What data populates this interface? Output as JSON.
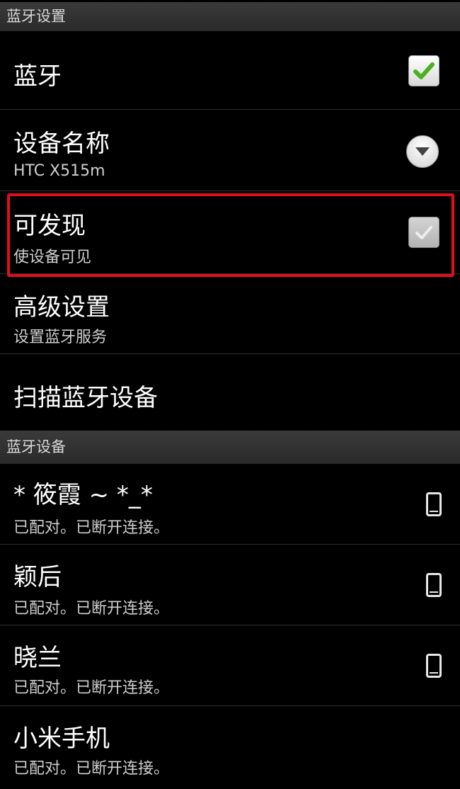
{
  "header_settings": {
    "label": "蓝牙设置"
  },
  "bluetooth": {
    "title": "蓝牙",
    "checked": true
  },
  "device_name": {
    "title": "设备名称",
    "value": "HTC X515m"
  },
  "discoverable": {
    "title": "可发现",
    "summary": "使设备可见",
    "checked": true
  },
  "advanced": {
    "title": "高级设置",
    "summary": "设置蓝牙服务"
  },
  "scan": {
    "title": "扫描蓝牙设备"
  },
  "header_devices": {
    "label": "蓝牙设备"
  },
  "devices": [
    {
      "name": "* 筱霞 ~ *_*",
      "status": "已配对。已断开连接。",
      "icon": "phone-icon"
    },
    {
      "name": "颖后",
      "status": "已配对。已断开连接。",
      "icon": "phone-icon"
    },
    {
      "name": "晓兰",
      "status": "已配对。已断开连接。",
      "icon": "phone-icon"
    },
    {
      "name": "小米手机",
      "status": "已配对。已断开连接。",
      "icon": "phone-icon"
    }
  ],
  "colors": {
    "checkmark_active": "#4caf1f",
    "checkmark_dim": "#e6e6e6",
    "highlight": "#e0101a"
  }
}
